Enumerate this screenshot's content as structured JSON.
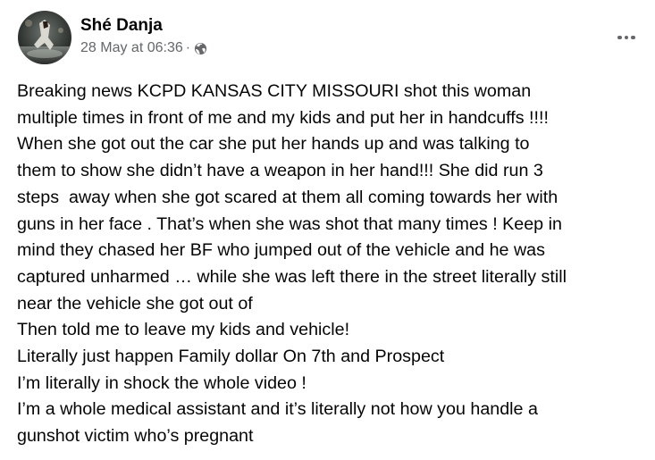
{
  "post": {
    "author": "Shé Danja",
    "timestamp": "28 May at 06:36",
    "separator": "·",
    "privacy_icon": "globe-icon",
    "more_icon": "more-options-icon",
    "text_lines": [
      "Breaking news KCPD KANSAS CITY MISSOURI shot this woman",
      "multiple times in front of me and my kids and put her in handcuffs !!!!",
      "When she got out the car she put her hands up and was talking to",
      "them to show she didn’t have a weapon in her hand!!! She did run 3",
      "steps  away when she got scared at them all coming towards her with",
      "guns in her face . That’s when she was shot that many times ! Keep in",
      "mind they chased her BF who jumped out of the vehicle and he was",
      "captured unharmed … while she was left there in the street literally still",
      "near the vehicle she got out of",
      "Then told me to leave my kids and vehicle!",
      "Literally just happen Family dollar On 7th and Prospect",
      "I’m literally in shock the whole video !",
      "I’m a whole medical assistant and it’s literally not how you handle a",
      "gunshot victim who’s pregnant"
    ]
  },
  "colors": {
    "text_primary": "#050505",
    "text_secondary": "#65676b",
    "background": "#ffffff"
  }
}
